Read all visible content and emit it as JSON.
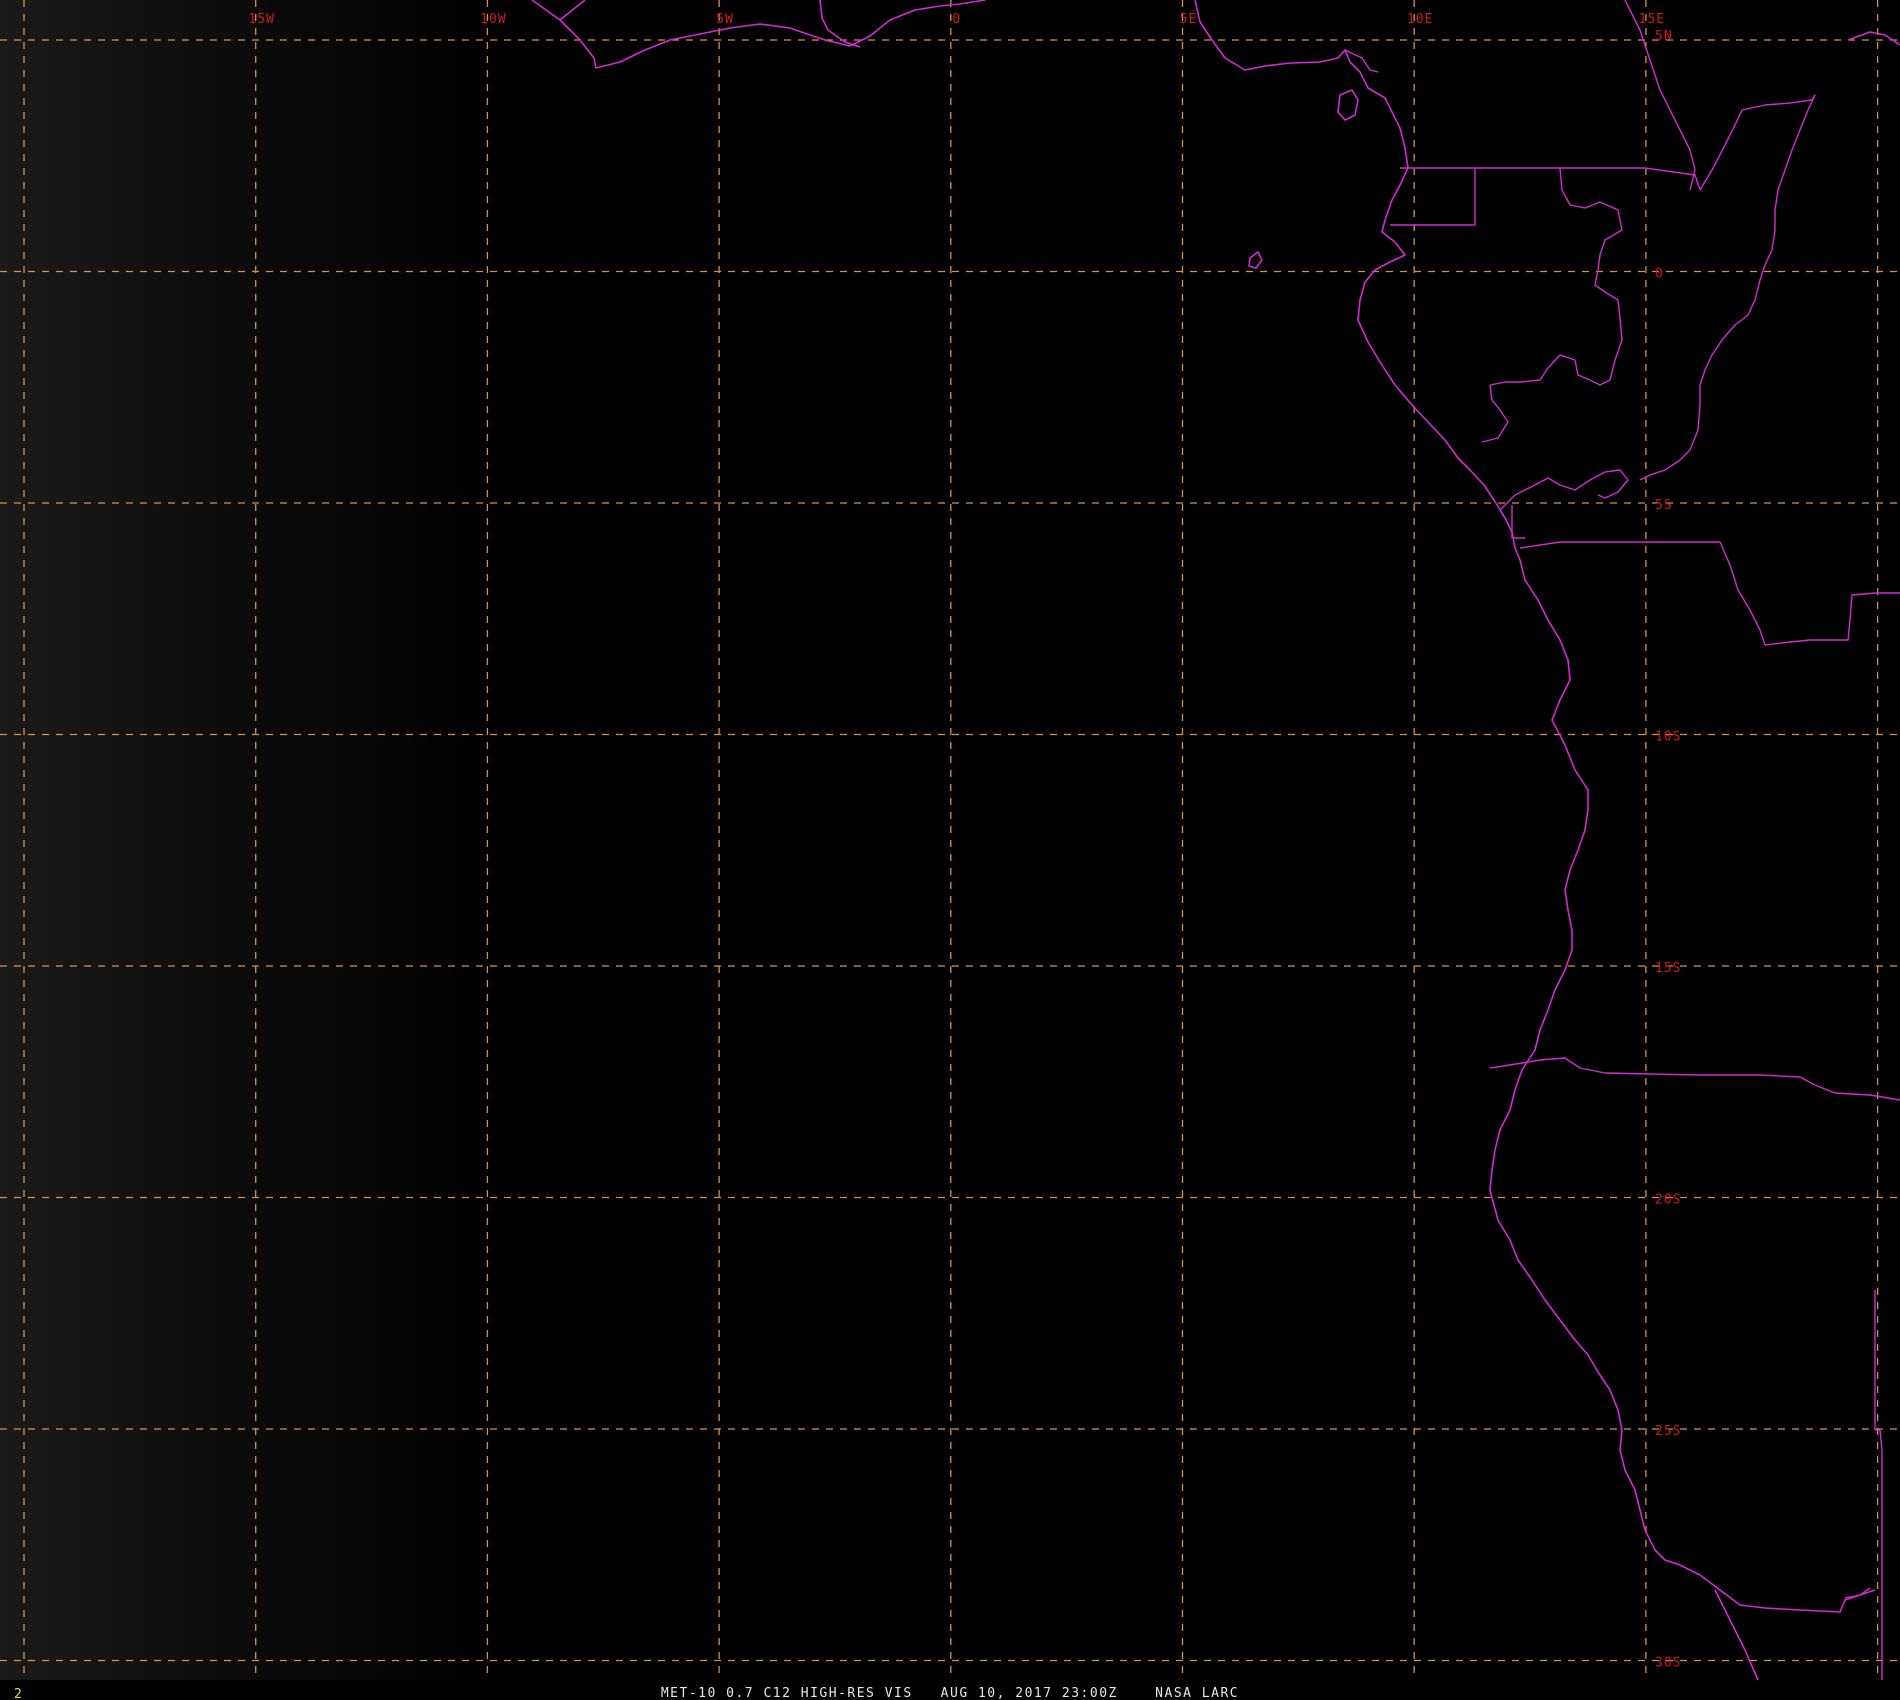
{
  "colors": {
    "background": "#000000",
    "gridline": "#d9904a",
    "grid_label": "#d01818",
    "coastline": "#d42ad4",
    "caption": "#e8e8e8",
    "frame_number": "#e8e800"
  },
  "grid": {
    "longitude_labels": [
      "15W",
      "10W",
      "5W",
      "0",
      "5E",
      "10E",
      "15E"
    ],
    "latitude_labels": [
      "5N",
      "0",
      "5S",
      "10S",
      "15S",
      "20S",
      "25S",
      "30S"
    ]
  },
  "footer": {
    "frame_number": "2",
    "caption": "MET-10 0.7 C12 HIGH-RES VIS   AUG 10, 2017 23:00Z    NASA LARC"
  }
}
